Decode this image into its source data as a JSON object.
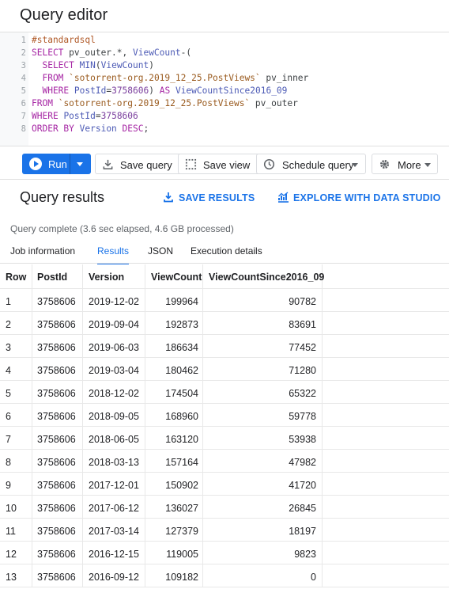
{
  "editor": {
    "title": "Query editor",
    "lines": [
      {
        "n": "1",
        "parts": [
          {
            "t": "#standardsql",
            "c": "cm"
          }
        ]
      },
      {
        "n": "2",
        "parts": [
          {
            "t": "SELECT",
            "c": "kw"
          },
          {
            "t": " pv_outer.*, ",
            "c": "plain"
          },
          {
            "t": "ViewCount",
            "c": "fn"
          },
          {
            "t": "-(",
            "c": "plain"
          }
        ]
      },
      {
        "n": "3",
        "parts": [
          {
            "t": "  SELECT",
            "c": "kw"
          },
          {
            "t": " ",
            "c": "plain"
          },
          {
            "t": "MIN",
            "c": "fn"
          },
          {
            "t": "(",
            "c": "plain"
          },
          {
            "t": "ViewCount",
            "c": "fn"
          },
          {
            "t": ")",
            "c": "plain"
          }
        ]
      },
      {
        "n": "4",
        "parts": [
          {
            "t": "  FROM",
            "c": "kw"
          },
          {
            "t": " ",
            "c": "plain"
          },
          {
            "t": "`sotorrent-org.2019_12_25.PostViews`",
            "c": "str"
          },
          {
            "t": " pv_inner",
            "c": "plain"
          }
        ]
      },
      {
        "n": "5",
        "parts": [
          {
            "t": "  WHERE",
            "c": "kw"
          },
          {
            "t": " ",
            "c": "plain"
          },
          {
            "t": "PostId",
            "c": "fn"
          },
          {
            "t": "=",
            "c": "plain"
          },
          {
            "t": "3758606",
            "c": "num"
          },
          {
            "t": ") ",
            "c": "plain"
          },
          {
            "t": "AS",
            "c": "kw"
          },
          {
            "t": " ",
            "c": "plain"
          },
          {
            "t": "ViewCountSince2016_09",
            "c": "fn"
          }
        ]
      },
      {
        "n": "6",
        "parts": [
          {
            "t": "FROM",
            "c": "kw"
          },
          {
            "t": " ",
            "c": "plain"
          },
          {
            "t": "`sotorrent-org.2019_12_25.PostViews`",
            "c": "str"
          },
          {
            "t": " pv_outer",
            "c": "plain"
          }
        ]
      },
      {
        "n": "7",
        "parts": [
          {
            "t": "WHERE",
            "c": "kw"
          },
          {
            "t": " ",
            "c": "plain"
          },
          {
            "t": "PostId",
            "c": "fn"
          },
          {
            "t": "=",
            "c": "plain"
          },
          {
            "t": "3758606",
            "c": "num"
          }
        ]
      },
      {
        "n": "8",
        "parts": [
          {
            "t": "ORDER BY",
            "c": "kw"
          },
          {
            "t": " ",
            "c": "plain"
          },
          {
            "t": "Version",
            "c": "fn"
          },
          {
            "t": " ",
            "c": "plain"
          },
          {
            "t": "DESC",
            "c": "kw"
          },
          {
            "t": ";",
            "c": "plain"
          }
        ]
      }
    ]
  },
  "toolbar": {
    "run_label": "Run",
    "save_query_label": "Save query",
    "save_view_label": "Save view",
    "schedule_label": "Schedule query",
    "more_label": "More"
  },
  "results": {
    "title": "Query results",
    "save_results_label": "SAVE RESULTS",
    "explore_label": "EXPLORE WITH DATA STUDIO",
    "status": "Query complete (3.6 sec elapsed, 4.6 GB processed)",
    "tabs": [
      "Job information",
      "Results",
      "JSON",
      "Execution details"
    ],
    "active_tab": "Results",
    "colors": {
      "accent": "#1a73e8"
    },
    "columns": [
      "Row",
      "PostId",
      "Version",
      "ViewCount",
      "ViewCountSince2016_09"
    ],
    "rows": [
      [
        "1",
        "3758606",
        "2019-12-02",
        "199964",
        "90782"
      ],
      [
        "2",
        "3758606",
        "2019-09-04",
        "192873",
        "83691"
      ],
      [
        "3",
        "3758606",
        "2019-06-03",
        "186634",
        "77452"
      ],
      [
        "4",
        "3758606",
        "2019-03-04",
        "180462",
        "71280"
      ],
      [
        "5",
        "3758606",
        "2018-12-02",
        "174504",
        "65322"
      ],
      [
        "6",
        "3758606",
        "2018-09-05",
        "168960",
        "59778"
      ],
      [
        "7",
        "3758606",
        "2018-06-05",
        "163120",
        "53938"
      ],
      [
        "8",
        "3758606",
        "2018-03-13",
        "157164",
        "47982"
      ],
      [
        "9",
        "3758606",
        "2017-12-01",
        "150902",
        "41720"
      ],
      [
        "10",
        "3758606",
        "2017-06-12",
        "136027",
        "26845"
      ],
      [
        "11",
        "3758606",
        "2017-03-14",
        "127379",
        "18197"
      ],
      [
        "12",
        "3758606",
        "2016-12-15",
        "119005",
        "9823"
      ],
      [
        "13",
        "3758606",
        "2016-09-12",
        "109182",
        "0"
      ]
    ]
  }
}
